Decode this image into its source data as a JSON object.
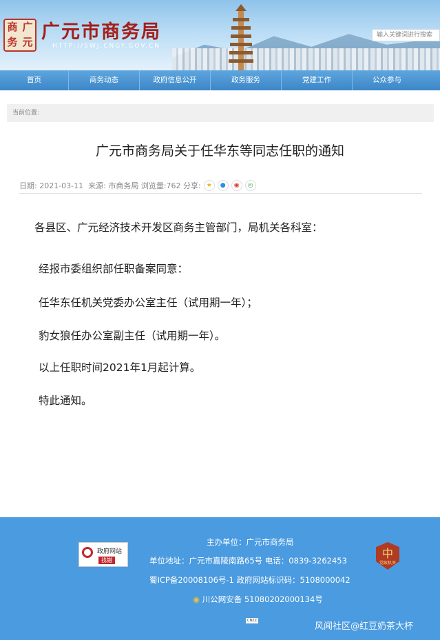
{
  "header": {
    "logo_chars": [
      "商",
      "广",
      "务",
      "元"
    ],
    "site_title": "广元市商务局",
    "site_url": "HTTP://SWJ.CNGY.GOV.CN",
    "search_placeholder": "输入关键词进行搜索"
  },
  "nav": {
    "items": [
      {
        "label": "首页"
      },
      {
        "label": "商务动态"
      },
      {
        "label": "政府信息公开"
      },
      {
        "label": "政务服务"
      },
      {
        "label": "党建工作"
      },
      {
        "label": "公众参与"
      }
    ]
  },
  "breadcrumb": {
    "label": "当前位置:"
  },
  "article": {
    "title": "广元市商务局关于任华东等同志任职的通知",
    "meta": "日期: 2021-03-11  来源: 市商务局 浏览量:762 分享:",
    "paragraphs": [
      "各县区、广元经济技术开发区商务主管部门，局机关各科室：",
      "经报市委组织部任职备案同意：",
      "任华东任机关党委办公室主任（试用期一年）；",
      "豹女狼任办公室副主任（试用期一年）。",
      "以上任职时间2021年1月起计算。",
      "特此通知。"
    ]
  },
  "share_icons": [
    {
      "name": "qzone-icon",
      "glyph": "★",
      "color": "#e8b820"
    },
    {
      "name": "qq-icon",
      "glyph": "●",
      "color": "#2d8fe3"
    },
    {
      "name": "weibo-icon",
      "glyph": "◉",
      "color": "#e3372d"
    },
    {
      "name": "wechat-icon",
      "glyph": "◎",
      "color": "#35b34a"
    }
  ],
  "footer": {
    "sponsor": "主办单位：广元市商务局",
    "address": "单位地址：广元市嘉陵南路65号  电话：0839-3262453",
    "icp": "蜀ICP备20008106号-1  政府网站标识码：5108000042",
    "police": "川公网安备 51080202000134号",
    "gov_badge_line1": "政府网站",
    "gov_badge_line2": "找错",
    "party_badge_sub": "党政机关",
    "cnzz": "CNZZ",
    "watermark": "风闻社区@红豆奶茶大杯"
  },
  "colors": {
    "nav_bg": "#3c86c8",
    "footer_bg": "#4a9be0",
    "title_red": "#a31f1a"
  }
}
